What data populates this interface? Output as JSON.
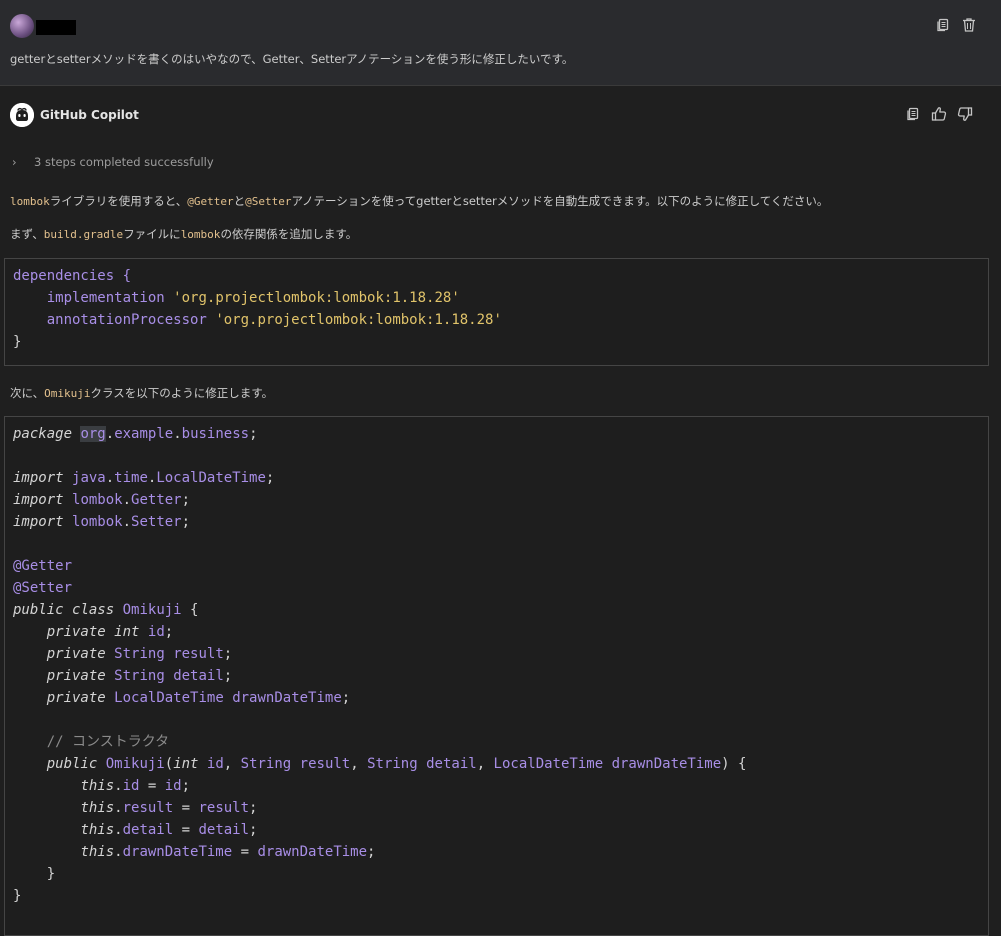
{
  "user_message": {
    "text": "getterとsetterメソッドを書くのはいやなので、Getter、Setterアノテーションを使う形に修正したいです。",
    "actions": [
      {
        "name": "copy-icon"
      },
      {
        "name": "trash-icon"
      }
    ]
  },
  "copilot": {
    "name": "GitHub Copilot",
    "actions": [
      {
        "name": "copy-icon"
      },
      {
        "name": "thumbs-up-icon"
      },
      {
        "name": "thumbs-down-icon"
      }
    ],
    "steps_label": "3 steps completed successfully",
    "para1": {
      "c1": "lombok",
      "t1": "ライブラリを使用すると、",
      "c2": "@Getter",
      "t2": "と",
      "c3": "@Setter",
      "t3": "アノテーションを使ってgetterとsetterメソッドを自動生成できます。以下のように修正してください。"
    },
    "para2": {
      "t1": "まず、",
      "c1": "build.gradle",
      "t2": "ファイルに",
      "c2": "lombok",
      "t3": "の依存関係を追加します。"
    },
    "para3": {
      "t1": "次に、",
      "c1": "Omikuji",
      "t2": "クラスを以下のように修正します。"
    },
    "gradle_code": {
      "l1": "dependencies {",
      "l2_kw": "implementation",
      "l2_str": "'org.projectlombok:lombok:1.18.28'",
      "l3_kw": "annotationProcessor",
      "l3_str": "'org.projectlombok:lombok:1.18.28'",
      "l4": "}"
    },
    "java_code": {
      "package_kw": "package",
      "package_org": "org",
      "package_rest1": "example",
      "package_rest2": "business",
      "import_kw": "import",
      "import1_a": "java",
      "import1_b": "time",
      "import1_c": "LocalDateTime",
      "import2_a": "lombok",
      "import2_b": "Getter",
      "import3_a": "lombok",
      "import3_b": "Setter",
      "ann1": "@Getter",
      "ann2": "@Setter",
      "public_kw": "public",
      "class_kw": "class",
      "class_name": "Omikuji",
      "private_kw": "private",
      "int_kw": "int",
      "f1": "id",
      "string_type": "String",
      "f2": "result",
      "f3": "detail",
      "ldt_type": "LocalDateTime",
      "f4": "drawnDateTime",
      "comment": "// コンストラクタ",
      "this_kw": "this"
    }
  }
}
